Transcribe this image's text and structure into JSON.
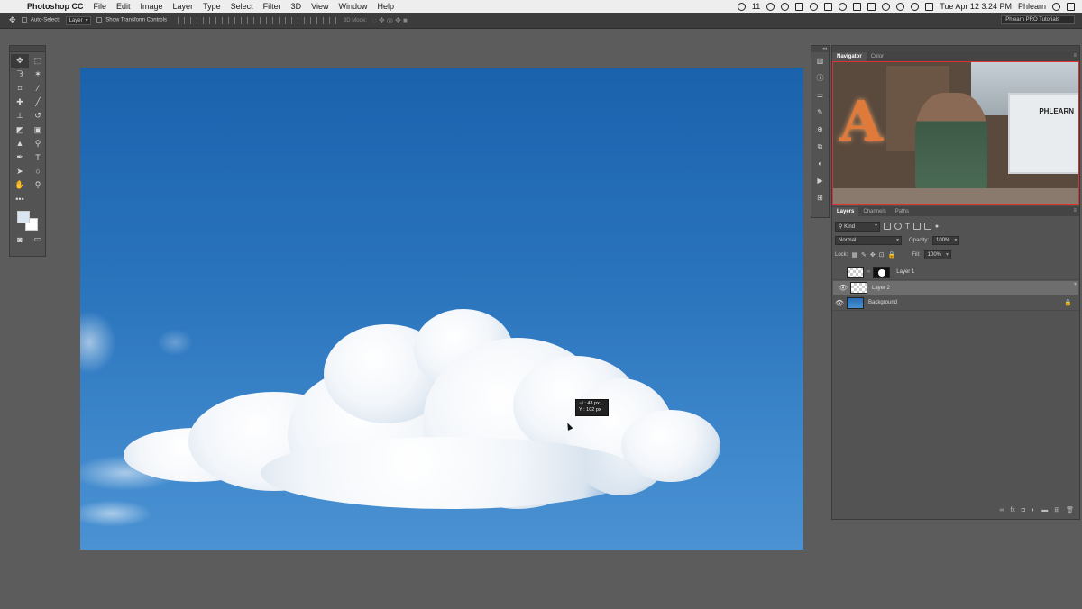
{
  "menubar": {
    "app": "Photoshop CC",
    "items": [
      "File",
      "Edit",
      "Image",
      "Layer",
      "Type",
      "Select",
      "Filter",
      "3D",
      "View",
      "Window",
      "Help"
    ],
    "badge_count": "11",
    "datetime": "Tue Apr 12  3:24 PM",
    "user": "Phlearn"
  },
  "options": {
    "auto_select_label": "Auto-Select:",
    "auto_select_value": "Layer",
    "transform_label": "Show Transform Controls",
    "mode_3d_label": "3D Mode:",
    "workspace": "Phlearn PRO Tutorials"
  },
  "canvas": {
    "tooltip_x": "⊣ :    43 px",
    "tooltip_y": "Y :  102 px"
  },
  "navigator": {
    "tabs": [
      "Navigator",
      "Color"
    ],
    "image_text": "PHLEARN",
    "letter": "A"
  },
  "layers": {
    "tabs": [
      "Layers",
      "Channels",
      "Paths"
    ],
    "filter_kind": "Kind",
    "blend_mode": "Normal",
    "opacity_label": "Opacity:",
    "opacity_value": "100%",
    "lock_label": "Lock:",
    "fill_label": "Fill:",
    "fill_value": "100%",
    "items": [
      {
        "name": "Layer 1",
        "visible": false,
        "selected": false
      },
      {
        "name": "Layer 2",
        "visible": true,
        "selected": true
      },
      {
        "name": "Background",
        "visible": true,
        "selected": false,
        "locked": true
      }
    ]
  },
  "colors": {
    "foreground": "#d9e6f2",
    "background": "#ffffff",
    "sky_top": "#1b62ad",
    "sky_bottom": "#4a92d2"
  }
}
